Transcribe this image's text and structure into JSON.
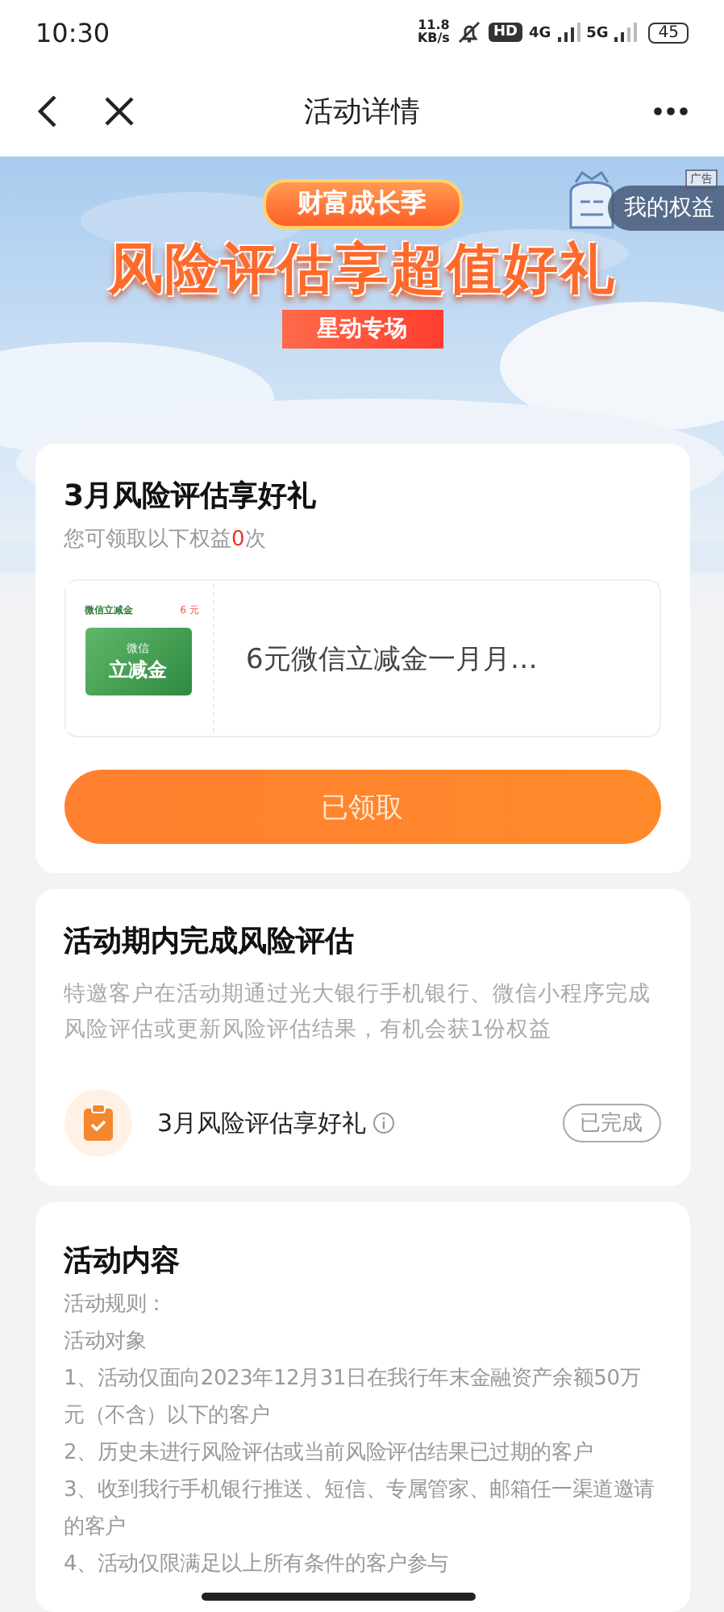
{
  "status_bar": {
    "time": "10:30",
    "net_speed": "11.8",
    "net_unit": "KB/s",
    "hd": "HD",
    "networks": [
      "4G",
      "5G"
    ],
    "battery": "45"
  },
  "nav": {
    "title": "活动详情"
  },
  "banner": {
    "ribbon": "财富成长季",
    "headline": "风险评估享超值好礼",
    "subtitle": "星动专场",
    "ad_label": "广告",
    "rights_button": "我的权益"
  },
  "reward_card": {
    "title": "3月风险评估享好礼",
    "count_prefix": "您可领取以下权益",
    "count": "0",
    "count_suffix": "次",
    "coupon": {
      "thumb_label": "微信立减金",
      "thumb_amount": "6 元",
      "card_line1": "微信",
      "card_line2": "立减金",
      "name": "6元微信立减金一月月…"
    },
    "button": "已领取"
  },
  "task_card": {
    "title": "活动期内完成风险评估",
    "description": "特邀客户在活动期通过光大银行手机银行、微信小程序完成风险评估或更新风险评估结果，有机会获1份权益",
    "task": {
      "name": "3月风险评估享好礼",
      "status": "已完成"
    }
  },
  "content_card": {
    "title": "活动内容",
    "lines": [
      "活动规则：",
      "活动对象",
      "1、活动仅面向2023年12月31日在我行年末金融资产余额50万元（不含）以下的客户",
      "2、历史未进行风险评估或当前风险评估结果已过期的客户",
      "3、收到我行手机银行推送、短信、专属管家、邮箱任一渠道邀请的客户",
      "4、活动仅限满足以上所有条件的客户参与"
    ]
  }
}
